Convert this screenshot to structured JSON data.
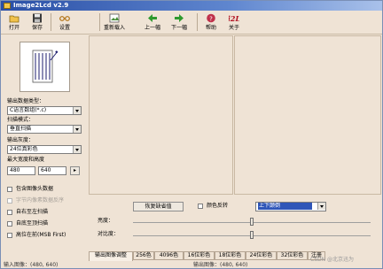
{
  "window": {
    "title": "Image2Lcd v2.9"
  },
  "toolbar": [
    {
      "label": "打开",
      "icon": "open-folder-icon"
    },
    {
      "label": "保存",
      "icon": "floppy-save-icon"
    },
    {
      "label": "设置",
      "icon": "glasses-settings-icon"
    },
    {
      "label": "重新载入",
      "icon": "reload-image-icon"
    },
    {
      "label": "上一幅",
      "icon": "arrow-left-icon"
    },
    {
      "label": "下一幅",
      "icon": "arrow-right-icon"
    },
    {
      "label": "帮助",
      "icon": "help-icon"
    },
    {
      "label": "关于",
      "icon": "about-i2l-icon"
    }
  ],
  "about_logo_text": "i2L",
  "left": {
    "output_type_label": "输出数据类型：",
    "output_type_value": "C语言数组(*.c)",
    "scan_mode_label": "扫描模式：",
    "scan_mode_value": "垂直扫描",
    "gray_label": "输出灰度：",
    "gray_value": "24位真彩色",
    "size_label": "最大宽度和高度",
    "width_value": "480",
    "height_value": "640",
    "arrow_btn": "▸",
    "options": [
      {
        "label": "包含图像头数据",
        "checked": false,
        "enabled": true
      },
      {
        "label": "字节内像素数据反序",
        "checked": false,
        "enabled": false
      },
      {
        "label": "自右至左扫描",
        "checked": false,
        "enabled": true
      },
      {
        "label": "自底至顶扫描",
        "checked": false,
        "enabled": true
      },
      {
        "label": "高位在前(MSB First)",
        "checked": false,
        "enabled": true
      }
    ]
  },
  "controls": {
    "restore_button": "恢复缺省值",
    "invert_label": "颜色反转",
    "invert_checked": false,
    "scan_dir_value": "上下颠倒",
    "brightness_label": "亮度：",
    "contrast_label": "对比度：",
    "brightness_level": 0.5,
    "contrast_level": 0.5
  },
  "tabs": [
    "输出图像调整",
    "256色",
    "4096色",
    "16位彩色",
    "18位彩色",
    "24位彩色",
    "32位彩色",
    "注册"
  ],
  "active_tab": 0,
  "status": {
    "left": "输入图像：(480, 640)",
    "right": "输出图像：(480, 640)"
  },
  "watermark": "CSDN @北京迅为"
}
